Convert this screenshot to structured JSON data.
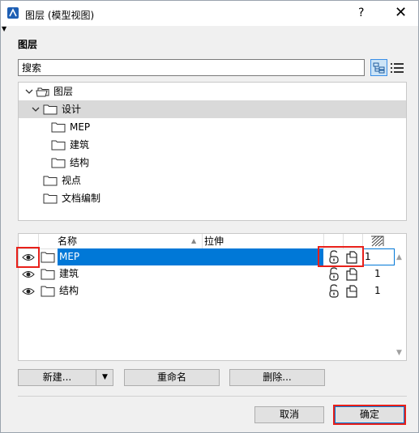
{
  "window": {
    "title": "图层 (模型视图)",
    "help_glyph": "?",
    "close_glyph": "✕",
    "collapse_glyph": "▼"
  },
  "section": {
    "title": "图层"
  },
  "search": {
    "placeholder": "搜索",
    "value": ""
  },
  "tree": {
    "items": [
      {
        "label": "图层",
        "level": 0,
        "expanded": true,
        "icon": "folder-stack-icon"
      },
      {
        "label": "设计",
        "level": 1,
        "expanded": true,
        "selected": true,
        "icon": "folder-icon"
      },
      {
        "label": "MEP",
        "level": 2,
        "icon": "folder-icon"
      },
      {
        "label": "建筑",
        "level": 2,
        "icon": "folder-icon"
      },
      {
        "label": "结构",
        "level": 2,
        "icon": "folder-icon"
      },
      {
        "label": "视点",
        "level": 1,
        "icon": "folder-icon"
      },
      {
        "label": "文档编制",
        "level": 1,
        "icon": "folder-icon"
      }
    ]
  },
  "table": {
    "headers": {
      "name": "名称",
      "extend": "拉伸",
      "sort_glyph": "▲"
    },
    "rows": [
      {
        "visible": true,
        "name": "MEP",
        "extend": "",
        "locked": false,
        "number": "1",
        "selected": true
      },
      {
        "visible": true,
        "name": "建筑",
        "extend": "",
        "locked": false,
        "number": "1",
        "selected": false
      },
      {
        "visible": true,
        "name": "结构",
        "extend": "",
        "locked": false,
        "number": "1",
        "selected": false
      }
    ],
    "scroll_up": "▲",
    "scroll_down": "▼"
  },
  "buttons": {
    "new": "新建...",
    "new_dropdown": "▼",
    "rename": "重命名",
    "delete": "删除...",
    "cancel": "取消",
    "ok": "确定"
  },
  "colors": {
    "selection": "#0078d7",
    "highlight_box": "#e8201a",
    "tree_selection": "#d9d9d9"
  }
}
